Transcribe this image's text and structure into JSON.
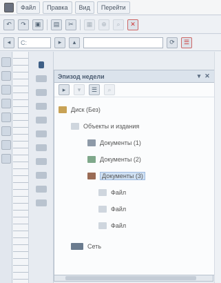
{
  "menubar": {
    "items": [
      "Файл",
      "Правка",
      "Вид",
      "Перейти"
    ]
  },
  "toolbar1": {
    "icons": [
      "undo-icon",
      "redo-icon",
      "copy-icon",
      "paste-icon",
      "cut-icon",
      "print-icon",
      "zoom-icon",
      "delete-icon"
    ]
  },
  "toolbar2": {
    "combo_value": "C:",
    "icons": [
      "back-icon",
      "forward-icon",
      "up-icon",
      "refresh-icon",
      "views-icon"
    ]
  },
  "panel": {
    "title": "Эпизод недели",
    "tree": [
      {
        "label": "Диск (Без)",
        "icon": "folder-icon",
        "level": 0
      },
      {
        "label": "Объекты и издания",
        "icon": "group-icon",
        "level": 1
      },
      {
        "label": "Документы (1)",
        "icon": "doc-icon",
        "level": 2
      },
      {
        "label": "Документы (2)",
        "icon": "doc-icon",
        "level": 2
      },
      {
        "label": "Документы (3)",
        "icon": "doc-icon",
        "level": 2
      },
      {
        "label": "Файл",
        "icon": "file-icon",
        "level": 3
      },
      {
        "label": "Файл",
        "icon": "file-icon",
        "level": 3
      },
      {
        "label": "Файл",
        "icon": "file-icon",
        "level": 3
      },
      {
        "label": "Сеть",
        "icon": "network-icon",
        "level": 1
      }
    ]
  }
}
